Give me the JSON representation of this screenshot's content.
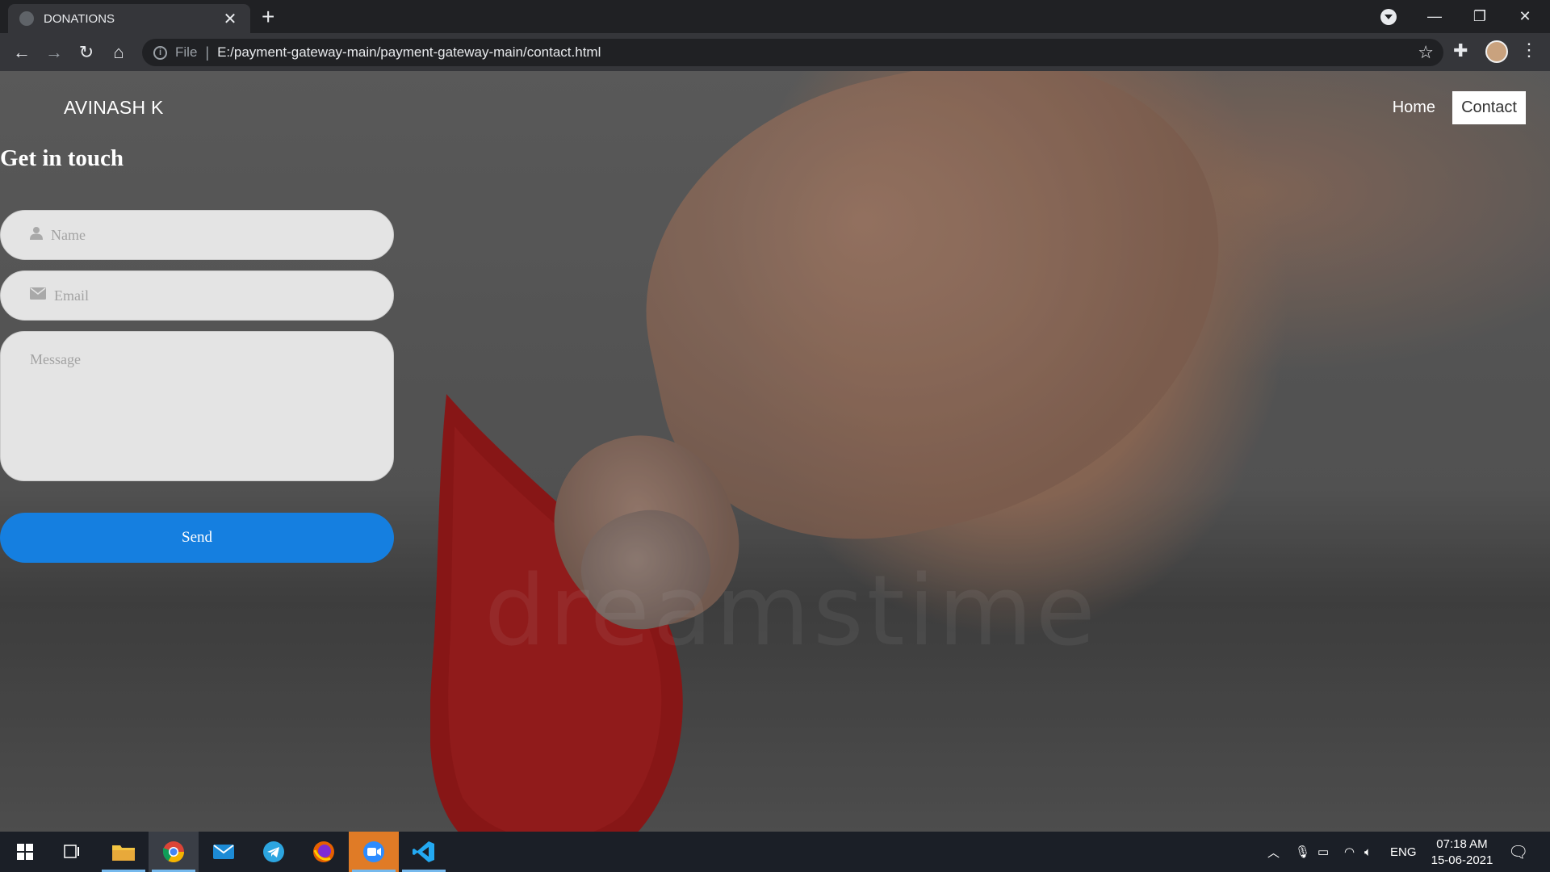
{
  "browser": {
    "tab_title": "DONATIONS",
    "tab_close": "✕",
    "new_tab": "+",
    "address_scheme": "File",
    "address_separator": "|",
    "url": "E:/payment-gateway-main/payment-gateway-main/contact.html"
  },
  "site": {
    "brand": "AVINASH K",
    "nav": [
      {
        "label": "Home",
        "active": false
      },
      {
        "label": "Contact",
        "active": true
      }
    ],
    "background_watermark": "dreamstime"
  },
  "form": {
    "heading": "Get in touch",
    "name_placeholder": "Name",
    "email_placeholder": "Email",
    "message_placeholder": "Message",
    "send_label": "Send"
  },
  "taskbar": {
    "language": "ENG",
    "time": "07:18 AM",
    "date": "15-06-2021",
    "apps": [
      "file-explorer",
      "chrome",
      "email",
      "telegram",
      "firefox",
      "zoom",
      "vscode"
    ]
  },
  "colors": {
    "send_button": "#157fe0",
    "input_bg": "#e4e4e4",
    "drop": "#b81e1e"
  }
}
